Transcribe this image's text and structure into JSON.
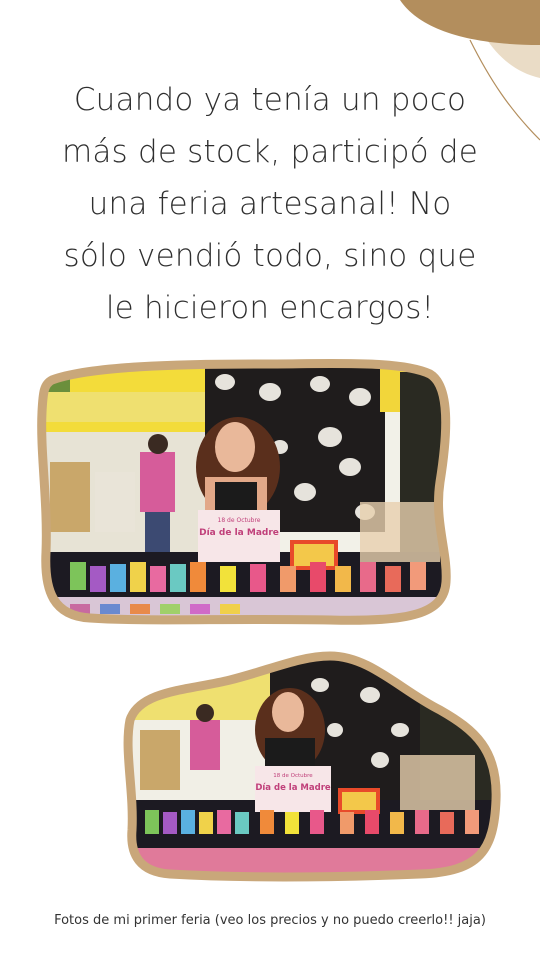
{
  "text": {
    "lines": [
      "Cuando ya tenía un poco",
      "más de stock, participó de",
      "una feria artesanal! No",
      "sólo vendió todo, sino que",
      "le hicieron encargos!"
    ],
    "caption": "Fotos de mi primer feria (veo los precios y no puedo creerlo!! jaja)"
  },
  "photo_text": {
    "poster_small": "18 de Octubre",
    "poster_title": "Día de la Madre"
  },
  "colors": {
    "frame": "#c9a77a",
    "deco_gold": "#b08b5a",
    "deco_light": "#e8d9c2",
    "text": "#2f2f2f"
  }
}
